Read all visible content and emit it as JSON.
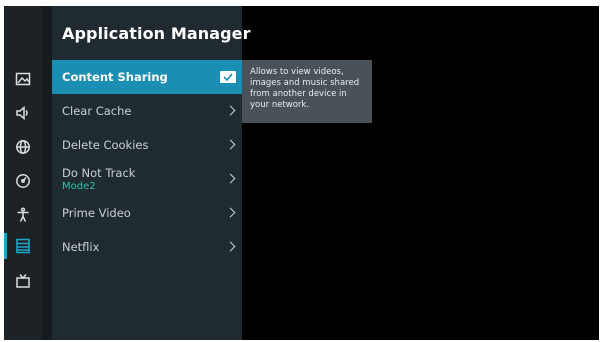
{
  "header": {
    "title": "Application Manager"
  },
  "sidebar": {
    "icons": [
      {
        "icon": "picture-icon"
      },
      {
        "icon": "speaker-icon"
      },
      {
        "icon": "globe-icon"
      },
      {
        "icon": "gauge-icon"
      },
      {
        "icon": "accessibility-icon"
      },
      {
        "icon": "app-list-icon",
        "selected": true
      },
      {
        "icon": "tv-icon"
      }
    ]
  },
  "menu": {
    "items": [
      {
        "label": "Content Sharing",
        "control": "checkbox",
        "checked": true,
        "active": true
      },
      {
        "label": "Clear Cache",
        "control": "chevron"
      },
      {
        "label": "Delete Cookies",
        "control": "chevron"
      },
      {
        "label": "Do Not Track",
        "sublabel": "Mode2",
        "control": "chevron"
      },
      {
        "label": "Prime Video",
        "control": "chevron"
      },
      {
        "label": "Netflix",
        "control": "chevron"
      }
    ]
  },
  "tooltip": {
    "text": "Allows to view videos, images and music shared from another device in your network."
  },
  "colors": {
    "accent": "#1b8fb3",
    "sublabel": "#2cc3a8",
    "panel": "#1f2a31",
    "background": "#000000"
  }
}
